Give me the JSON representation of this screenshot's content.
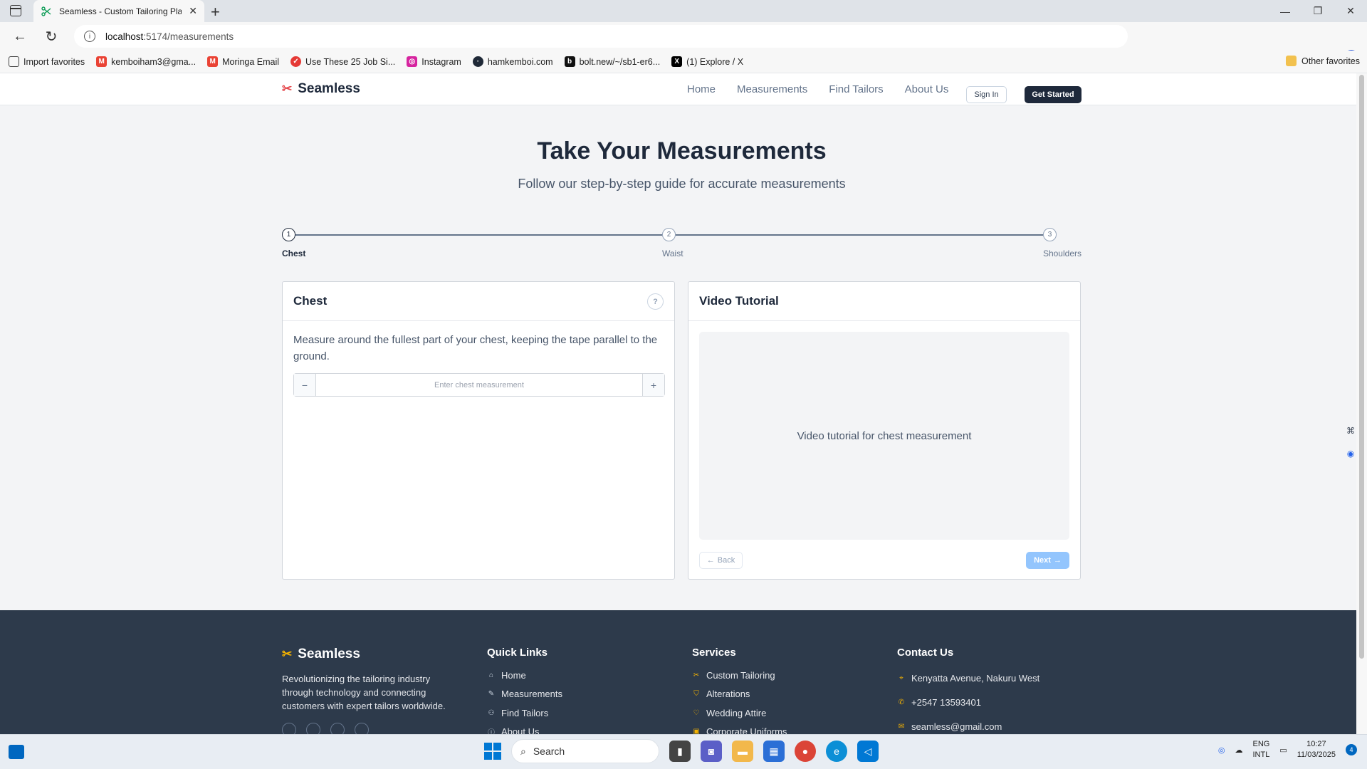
{
  "browser": {
    "tab_title": "Seamless - Custom Tailoring Plat",
    "url_host": "localhost",
    "url_path": ":5174/measurements",
    "favorites": [
      {
        "label": "Import favorites",
        "icon": "import-icon",
        "color": "#444444"
      },
      {
        "label": "kemboiham3@gma...",
        "icon": "gmail-icon",
        "color": "#ea4335"
      },
      {
        "label": "Moringa Email",
        "icon": "gmail-icon",
        "color": "#ea4335"
      },
      {
        "label": "Use These 25 Job Si...",
        "icon": "site-icon",
        "color": "#e53935"
      },
      {
        "label": "Instagram",
        "icon": "instagram-icon",
        "color": "#d6249f"
      },
      {
        "label": "hamkemboi.com",
        "icon": "site-icon",
        "color": "#1f2937"
      },
      {
        "label": "bolt.new/~/sb1-er6...",
        "icon": "bolt-icon",
        "color": "#111111"
      },
      {
        "label": "(1) Explore / X",
        "icon": "x-icon",
        "color": "#000000"
      }
    ],
    "other_favorites": "Other favorites"
  },
  "site": {
    "brand": "Seamless",
    "nav": [
      "Home",
      "Measurements",
      "Find Tailors",
      "About Us"
    ],
    "sign_in": "Sign In",
    "get_started": "Get Started"
  },
  "hero": {
    "title": "Take Your Measurements",
    "subtitle": "Follow our step-by-step guide for accurate measurements"
  },
  "steps": [
    {
      "number": "1",
      "label": "Chest",
      "active": true
    },
    {
      "number": "2",
      "label": "Waist",
      "active": false
    },
    {
      "number": "3",
      "label": "Shoulders",
      "active": false
    }
  ],
  "measure_card": {
    "title": "Chest",
    "description": "Measure around the fullest part of your chest, keeping the tape parallel to the ground.",
    "placeholder": "Enter chest measurement",
    "minus": "−",
    "plus": "+"
  },
  "video_card": {
    "title": "Video Tutorial",
    "video_text": "Video tutorial for chest measurement",
    "back": "Back",
    "next": "Next"
  },
  "footer": {
    "brand": "Seamless",
    "about": "Revolutionizing the tailoring industry through technology and connecting customers with expert tailors worldwide.",
    "quick_links_title": "Quick Links",
    "quick_links": [
      "Home",
      "Measurements",
      "Find Tailors",
      "About Us"
    ],
    "services_title": "Services",
    "services": [
      "Custom Tailoring",
      "Alterations",
      "Wedding Attire",
      "Corporate Uniforms"
    ],
    "contact_title": "Contact Us",
    "contact": [
      "Kenyatta Avenue, Nakuru West",
      "+2547 13593401",
      "seamless@gmail.com"
    ]
  },
  "taskbar": {
    "search": "Search",
    "lang_1": "ENG",
    "lang_2": "INTL",
    "time": "10:27",
    "date": "11/03/2025",
    "notifications": "4"
  },
  "colors": {
    "brand_dark": "#1e293b",
    "footer_bg": "#2d3a4b",
    "accent_gold": "#f5b300",
    "next_button": "#93c5fd"
  }
}
